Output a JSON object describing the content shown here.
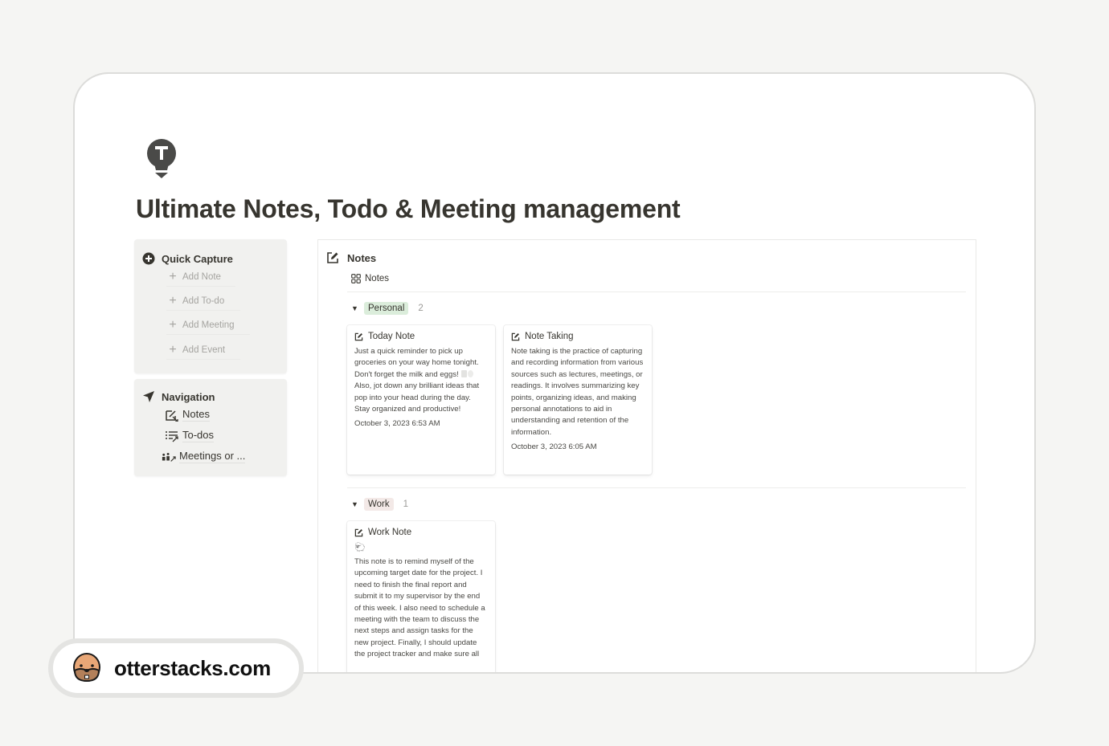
{
  "page": {
    "icon": "lightbulb-t-icon",
    "title": "Ultimate Notes, Todo & Meeting management"
  },
  "quick_capture": {
    "icon": "plus-circle-icon",
    "heading": "Quick Capture",
    "buttons": [
      {
        "label": "Add Note",
        "icon": "plus-icon"
      },
      {
        "label": "Add To-do",
        "icon": "plus-icon"
      },
      {
        "label": "Add Meeting",
        "icon": "plus-icon"
      },
      {
        "label": "Add Event",
        "icon": "plus-icon"
      }
    ]
  },
  "navigation": {
    "icon": "location-arrow-icon",
    "heading": "Navigation",
    "links": [
      {
        "label": "Notes",
        "icon": "edit-link-icon"
      },
      {
        "label": "To-dos",
        "icon": "list-link-icon"
      },
      {
        "label": "Meetings or ...",
        "icon": "people-link-icon"
      }
    ]
  },
  "database": {
    "icon": "edit-icon",
    "title": "Notes",
    "view": {
      "icon": "gallery-icon",
      "label": "Notes"
    },
    "groups": [
      {
        "label": "Personal",
        "count": "2",
        "color": "#dbeddb",
        "cards": [
          {
            "title": "Today Note",
            "body_before": "Just a quick reminder to pick up groceries on your way home tonight. Don't forget the milk and eggs! ",
            "body_after": " Also, jot down any brilliant ideas that pop into your head during the day. Stay organized and productive!",
            "date": "October 3, 2023 6:53 AM"
          },
          {
            "title": "Note Taking",
            "body": "Note taking is the practice of capturing and recording information from various sources such as lectures, meetings, or readings. It involves summarizing key points, organizing ideas, and making personal annotations to aid in understanding and retention of the information.",
            "date": "October 3, 2023 6:05 AM"
          }
        ]
      },
      {
        "label": "Work",
        "count": "1",
        "color": "#f3e9e7",
        "cards": [
          {
            "title": "Work Note",
            "emoji": "🐑",
            "body": "This note is to remind myself of the upcoming target date for the project. I need to finish the final report and submit it to my supervisor by the end of this week. I also need to schedule a meeting with the team to discuss the next steps and assign tasks for the new project. Finally, I should update the project tracker and make sure all"
          }
        ]
      }
    ]
  },
  "watermark": {
    "icon": "otter-face-icon",
    "text": "otterstacks.com"
  }
}
